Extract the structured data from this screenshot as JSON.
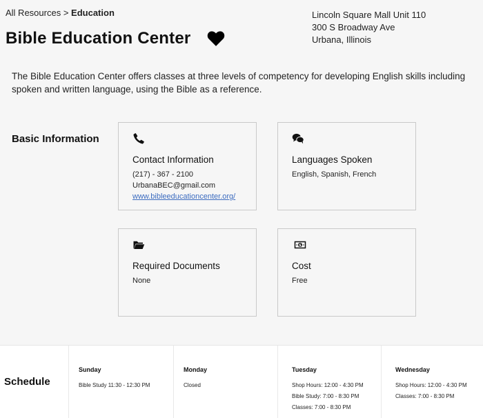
{
  "breadcrumb": {
    "root": "All Resources",
    "separator": ">",
    "current": "Education"
  },
  "page_title": "Bible Education Center",
  "address": [
    "Lincoln Square Mall Unit 110",
    "300 S Broadway Ave",
    "Urbana, Illinois"
  ],
  "description": "The Bible Education Center offers classes at three levels of competency for developing English skills including spoken and written language, using the Bible as a reference.",
  "icons": {
    "favorite": "heart-icon",
    "contact": "phone-icon",
    "languages": "chat-bubbles-icon",
    "documents": "folder-icon",
    "cost": "money-icon"
  },
  "basic_info": {
    "label": "Basic Information",
    "contact": {
      "title": "Contact Information",
      "phone": "(217) - 367 - 2100",
      "email": "UrbanaBEC@gmail.com",
      "website": "www.bibleeducationcenter.org/"
    },
    "languages": {
      "title": "Languages Spoken",
      "value": "English, Spanish, French"
    },
    "documents": {
      "title": "Required Documents",
      "value": "None"
    },
    "cost": {
      "title": "Cost",
      "value": "Free"
    }
  },
  "schedule": {
    "label": "Schedule",
    "days": [
      {
        "day": "Sunday",
        "hours": [
          "Bible Study 11:30 - 12:30 PM"
        ]
      },
      {
        "day": "Monday",
        "hours": [
          "Closed"
        ]
      },
      {
        "day": "Tuesday",
        "hours": [
          "Shop Hours: 12:00 - 4:30 PM",
          "Bible Study: 7:00 - 8:30 PM",
          "Classes: 7:00 - 8:30 PM"
        ]
      },
      {
        "day": "Wednesday",
        "hours": [
          "Shop Hours: 12:00 - 4:30 PM",
          "Classes: 7:00 - 8:30 PM"
        ]
      }
    ]
  },
  "colors": {
    "link": "#3b6bbf",
    "background": "#f6f6f6",
    "card_border": "#c9c9c9"
  }
}
